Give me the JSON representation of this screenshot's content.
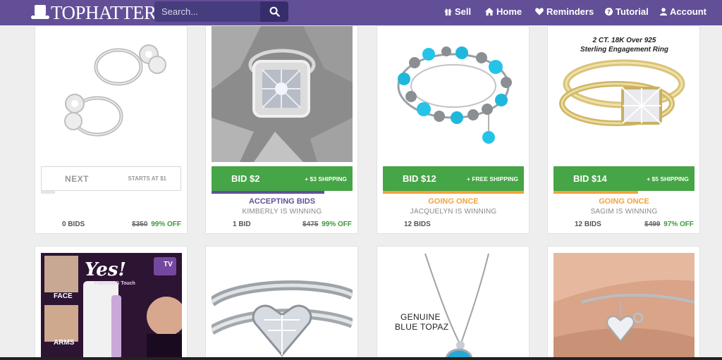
{
  "header": {
    "logo_text": "TOPHATTER",
    "search": {
      "placeholder": "Search..."
    },
    "nav": [
      {
        "label": "Sell",
        "icon": "gift-icon"
      },
      {
        "label": "Home",
        "icon": "home-icon"
      },
      {
        "label": "Reminders",
        "icon": "heart-icon"
      },
      {
        "label": "Tutorial",
        "icon": "question-circle-icon"
      },
      {
        "label": "Account",
        "icon": "user-icon"
      }
    ]
  },
  "colors": {
    "brand": "#624f98",
    "bid_green": "#46a546",
    "accepting": "#624f98",
    "going": "#f2a33a",
    "off_green": "#3a9a3a"
  },
  "row1": [
    {
      "next_label": "NEXT",
      "starts": "STARTS AT $1",
      "bids": "0 BIDS",
      "old_price": "$350",
      "discount": "99% OFF",
      "progress": 0.1
    },
    {
      "bid": "BID $2",
      "ship": "+ $3 SHIPPING",
      "status": "ACCEPTING BIDS",
      "winner": "KIMBERLY IS WINNING",
      "bids": "1 BID",
      "old_price": "$475",
      "discount": "99% OFF",
      "progress": 0.8
    },
    {
      "bid": "BID $12",
      "ship": "+ FREE SHIPPING",
      "status": "GOING ONCE",
      "winner": "JACQUELYN IS WINNING",
      "bids": "12 BIDS",
      "progress": 1.0
    },
    {
      "bid": "BID $14",
      "ship": "+ $5 SHIPPING",
      "status": "GOING ONCE",
      "winner": "SAGIM IS WINNING",
      "bids": "12 BIDS",
      "old_price": "$499",
      "discount": "97% OFF",
      "progress": 0.6,
      "image_text": [
        "2 CT. 18K Over 925",
        "Sterling Engagement Ring"
      ]
    }
  ],
  "row2": [
    {
      "image_text": {
        "yes": "Yes!",
        "tagline": "FINISHING Touch",
        "face": "FACE",
        "arms": "ARMS",
        "badge": "TV"
      }
    },
    {},
    {
      "image_text": [
        "GENUINE",
        "BLUE TOPAZ"
      ]
    },
    {}
  ]
}
